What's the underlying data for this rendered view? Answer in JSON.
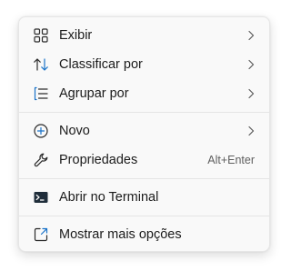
{
  "menu": {
    "items": [
      {
        "label": "Exibir",
        "icon": "grid-view-icon",
        "submenu": true
      },
      {
        "label": "Classificar por",
        "icon": "sort-icon",
        "submenu": true
      },
      {
        "label": "Agrupar por",
        "icon": "group-by-icon",
        "submenu": true
      },
      {
        "label": "Novo",
        "icon": "new-plus-icon",
        "submenu": true
      },
      {
        "label": "Propriedades",
        "icon": "wrench-icon",
        "shortcut": "Alt+Enter"
      },
      {
        "label": "Abrir no Terminal",
        "icon": "terminal-icon"
      },
      {
        "label": "Mostrar mais opções",
        "icon": "open-external-icon"
      }
    ]
  },
  "colors": {
    "menu_background": "#f9f9f9",
    "text": "#1b1b1b",
    "shortcut_text": "#5f5f5f",
    "separator": "#e5e5e5",
    "terminal_icon": "#1f2d3a"
  }
}
